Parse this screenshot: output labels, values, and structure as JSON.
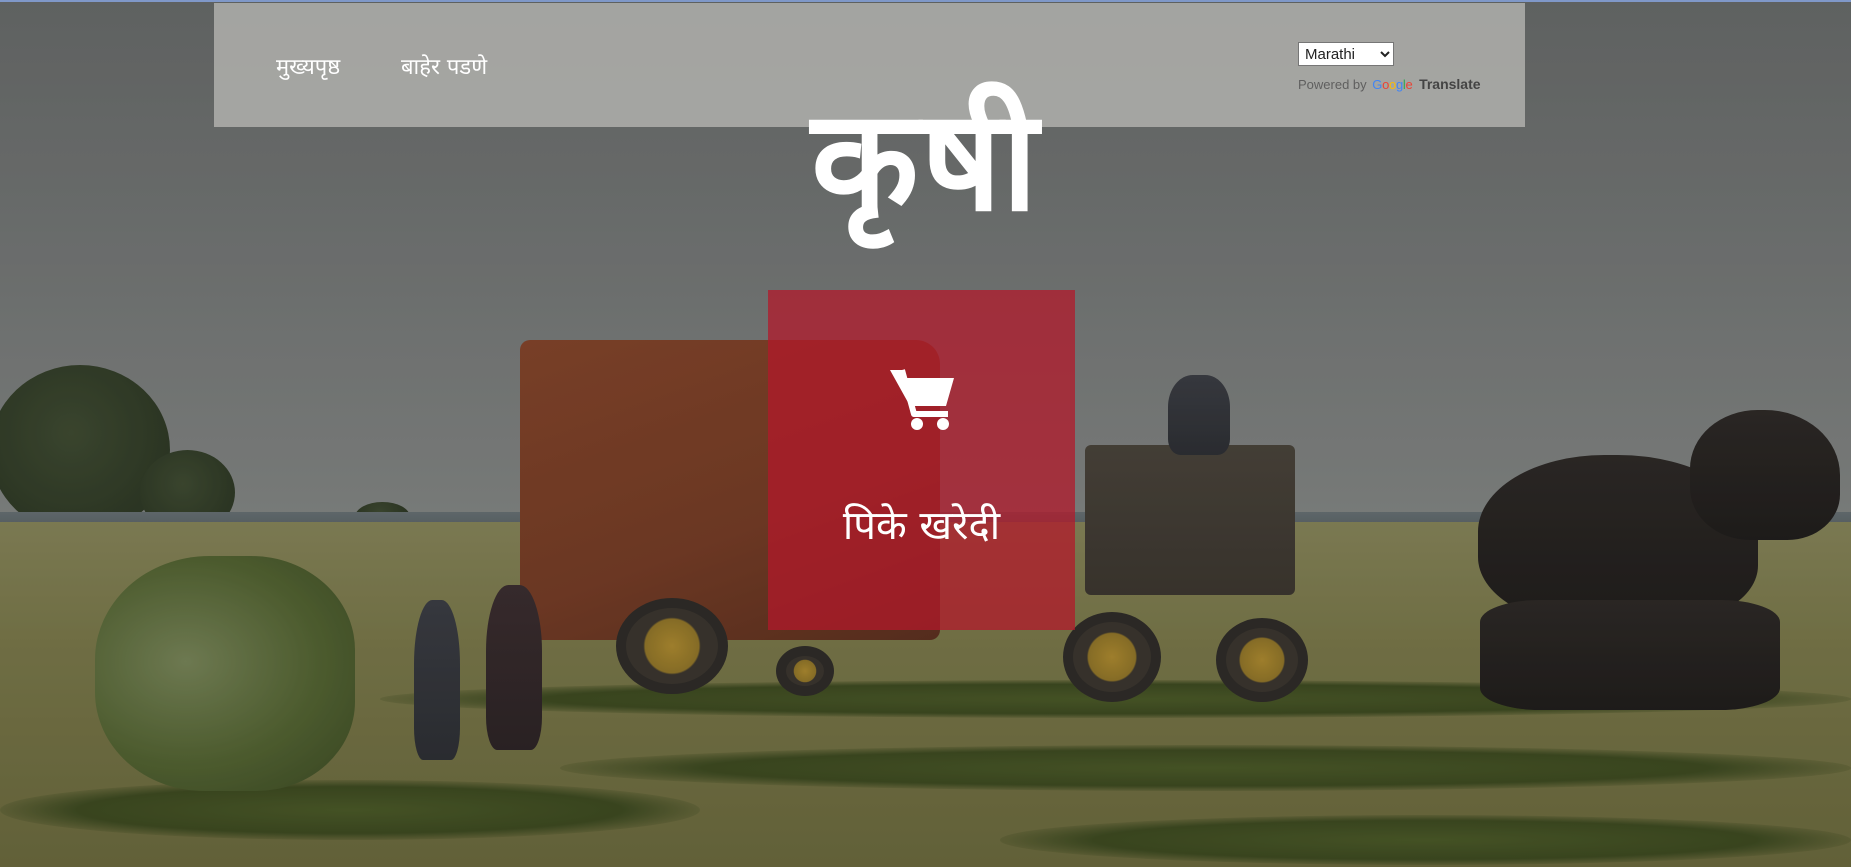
{
  "nav": {
    "home_label": "मुख्यपृष्ठ",
    "logout_label": "बाहेर पडणे"
  },
  "translate": {
    "selected_language": "Marathi",
    "powered_by": "Powered by",
    "google_word": "Google",
    "translate_label": "Translate"
  },
  "hero": {
    "title": "कृषी"
  },
  "buy_tile": {
    "label": "पिके खरेदी",
    "icon": "shopping-cart-icon",
    "color": "#b2182a"
  },
  "background": {
    "subject": "farm-field-with-baler-and-horses"
  }
}
